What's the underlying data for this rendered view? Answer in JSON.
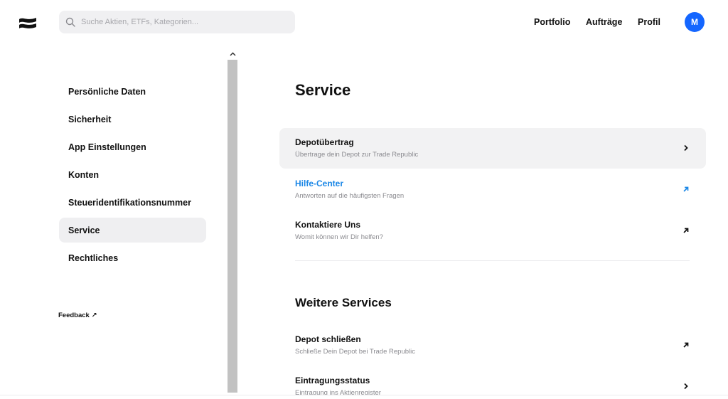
{
  "header": {
    "search_placeholder": "Suche Aktien, ETFs, Kategorien...",
    "nav": [
      "Portfolio",
      "Aufträge",
      "Profil"
    ],
    "avatar_initial": "M"
  },
  "sidebar": {
    "items": [
      {
        "label": "Persönliche Daten"
      },
      {
        "label": "Sicherheit"
      },
      {
        "label": "App Einstellungen"
      },
      {
        "label": "Konten"
      },
      {
        "label": "Steueridentifikationsnummer"
      },
      {
        "label": "Service",
        "active": true
      },
      {
        "label": "Rechtliches"
      }
    ],
    "feedback_label": "Feedback ↗"
  },
  "main": {
    "title": "Service",
    "rows": [
      {
        "title": "Depotübertrag",
        "subtitle": "Übertrage dein Depot zur Trade Republic",
        "icon": "chevron-right-icon"
      },
      {
        "title": "Hilfe-Center",
        "subtitle": "Antworten auf die häufigsten Fragen",
        "icon": "external-link-icon"
      },
      {
        "title": "Kontaktiere Uns",
        "subtitle": "Womit können wir Dir helfen?",
        "icon": "external-link-icon"
      }
    ],
    "section2_title": "Weitere Services",
    "rows2": [
      {
        "title": "Depot schließen",
        "subtitle": "Schließe Dein Depot bei Trade Republic",
        "icon": "external-link-icon"
      },
      {
        "title": "Eintragungsstatus",
        "subtitle": "Eintragung ins Aktienregister",
        "icon": "chevron-right-icon"
      }
    ]
  },
  "colors": {
    "accent": "#1466ff",
    "link": "#1b87e6",
    "active_bg": "#efeff1"
  }
}
